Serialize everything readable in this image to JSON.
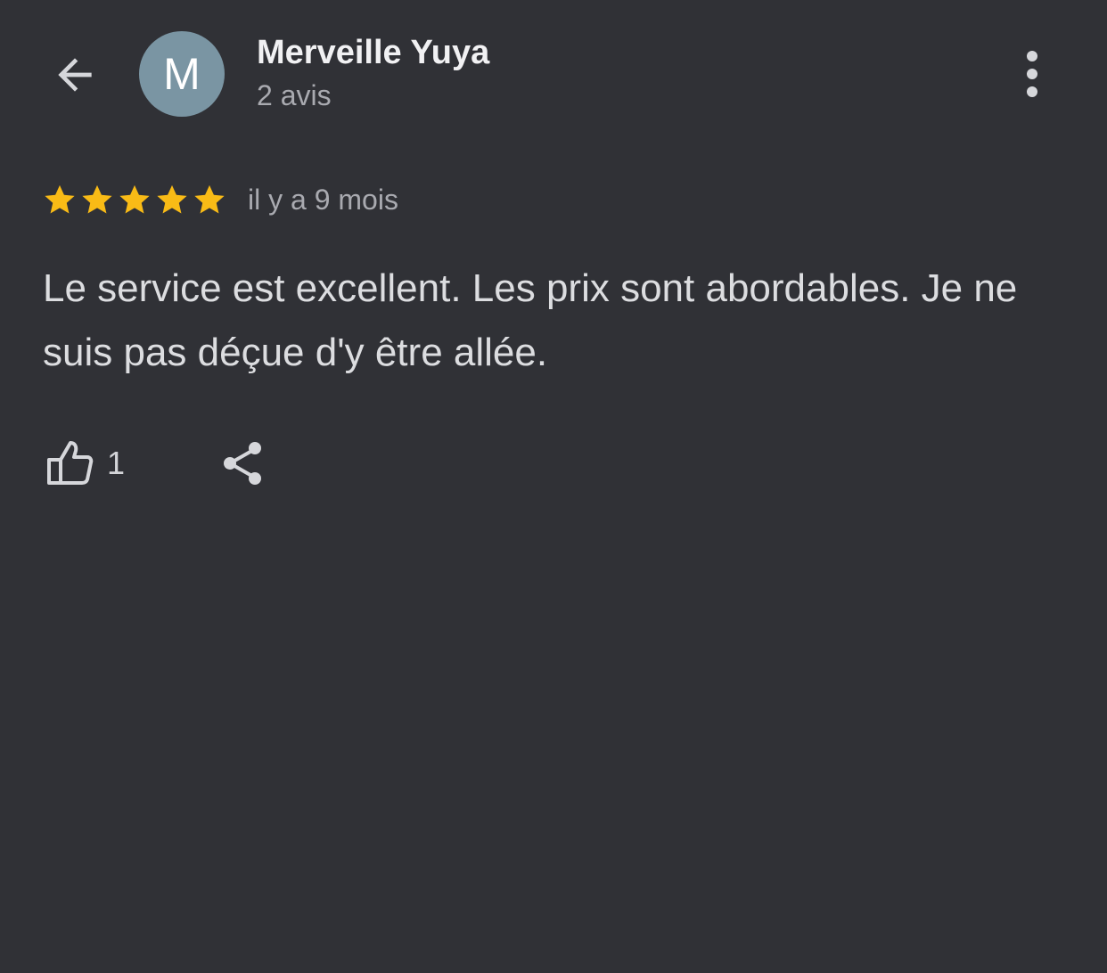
{
  "header": {
    "author_initial": "M",
    "author_name": "Merveille Yuya",
    "review_count": "2 avis"
  },
  "review": {
    "rating": 5,
    "rating_max": 5,
    "date": "il y a 9 mois",
    "text": "Le service est excellent. Les prix sont abordables. Je ne suis pas déçue d'y être allée.",
    "like_count": "1"
  },
  "icons": {
    "back": "arrow-left-icon",
    "more": "more-vertical-icon",
    "star": "star-icon",
    "like": "thumb-up-icon",
    "share": "share-icon"
  },
  "colors": {
    "background": "#303136",
    "avatar": "#7a95a3",
    "star": "#f9bb16",
    "text_primary": "#f1f1f3",
    "text_secondary": "#a9aab0"
  }
}
